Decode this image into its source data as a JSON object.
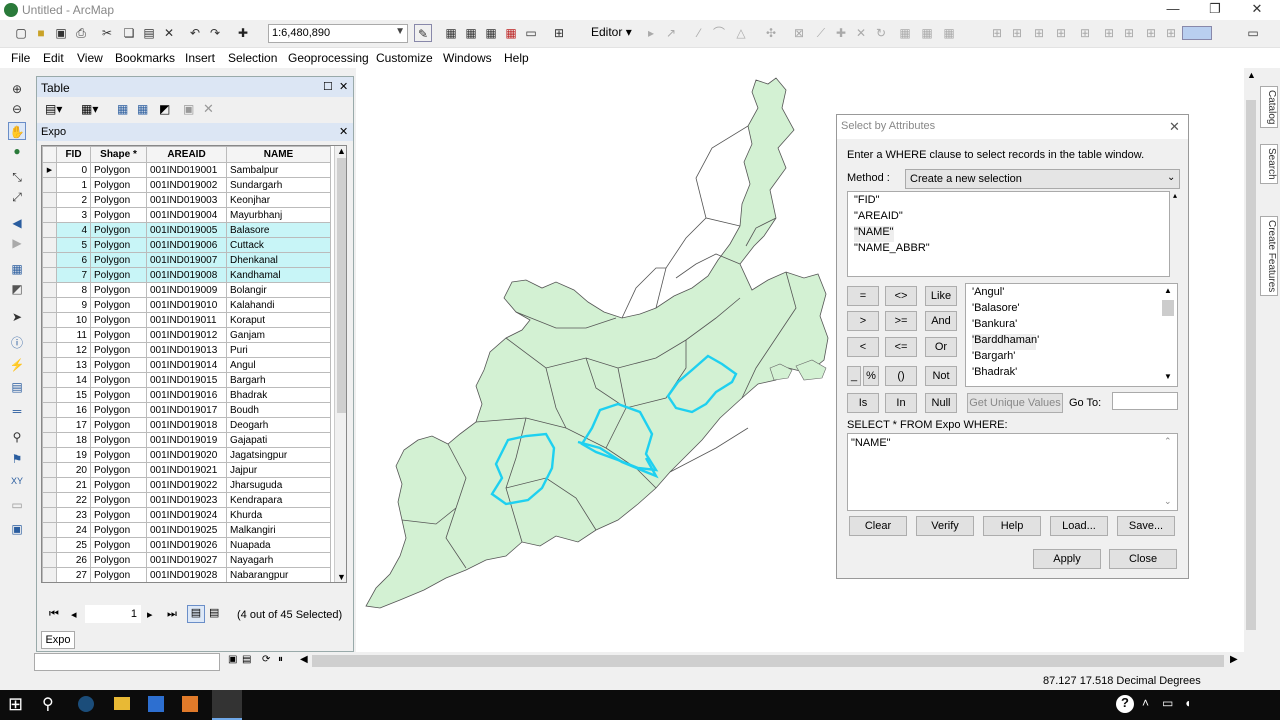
{
  "window": {
    "title": "Untitled - ArcMap"
  },
  "toolbar": {
    "scale_value": "1:6,480,890",
    "editor_label": "Editor"
  },
  "menu": [
    "File",
    "Edit",
    "View",
    "Bookmarks",
    "Insert",
    "Selection",
    "Geoprocessing",
    "Customize",
    "Windows",
    "Help"
  ],
  "table_window": {
    "title": "Table",
    "layer_tab": "Expo",
    "columns": [
      "FID",
      "Shape *",
      "AREAID",
      "NAME"
    ],
    "rows": [
      {
        "fid": "0",
        "shape": "Polygon",
        "areaid": "001IND019001",
        "name": "Sambalpur",
        "selected": false
      },
      {
        "fid": "1",
        "shape": "Polygon",
        "areaid": "001IND019002",
        "name": "Sundargarh",
        "selected": false
      },
      {
        "fid": "2",
        "shape": "Polygon",
        "areaid": "001IND019003",
        "name": "Keonjhar",
        "selected": false
      },
      {
        "fid": "3",
        "shape": "Polygon",
        "areaid": "001IND019004",
        "name": "Mayurbhanj",
        "selected": false
      },
      {
        "fid": "4",
        "shape": "Polygon",
        "areaid": "001IND019005",
        "name": "Balasore",
        "selected": true
      },
      {
        "fid": "5",
        "shape": "Polygon",
        "areaid": "001IND019006",
        "name": "Cuttack",
        "selected": true
      },
      {
        "fid": "6",
        "shape": "Polygon",
        "areaid": "001IND019007",
        "name": "Dhenkanal",
        "selected": true
      },
      {
        "fid": "7",
        "shape": "Polygon",
        "areaid": "001IND019008",
        "name": "Kandhamal",
        "selected": true
      },
      {
        "fid": "8",
        "shape": "Polygon",
        "areaid": "001IND019009",
        "name": "Bolangir",
        "selected": false
      },
      {
        "fid": "9",
        "shape": "Polygon",
        "areaid": "001IND019010",
        "name": "Kalahandi",
        "selected": false
      },
      {
        "fid": "10",
        "shape": "Polygon",
        "areaid": "001IND019011",
        "name": "Koraput",
        "selected": false
      },
      {
        "fid": "11",
        "shape": "Polygon",
        "areaid": "001IND019012",
        "name": "Ganjam",
        "selected": false
      },
      {
        "fid": "12",
        "shape": "Polygon",
        "areaid": "001IND019013",
        "name": "Puri",
        "selected": false
      },
      {
        "fid": "13",
        "shape": "Polygon",
        "areaid": "001IND019014",
        "name": "Angul",
        "selected": false
      },
      {
        "fid": "14",
        "shape": "Polygon",
        "areaid": "001IND019015",
        "name": "Bargarh",
        "selected": false
      },
      {
        "fid": "15",
        "shape": "Polygon",
        "areaid": "001IND019016",
        "name": "Bhadrak",
        "selected": false
      },
      {
        "fid": "16",
        "shape": "Polygon",
        "areaid": "001IND019017",
        "name": "Boudh",
        "selected": false
      },
      {
        "fid": "17",
        "shape": "Polygon",
        "areaid": "001IND019018",
        "name": "Deogarh",
        "selected": false
      },
      {
        "fid": "18",
        "shape": "Polygon",
        "areaid": "001IND019019",
        "name": "Gajapati",
        "selected": false
      },
      {
        "fid": "19",
        "shape": "Polygon",
        "areaid": "001IND019020",
        "name": "Jagatsingpur",
        "selected": false
      },
      {
        "fid": "20",
        "shape": "Polygon",
        "areaid": "001IND019021",
        "name": "Jajpur",
        "selected": false
      },
      {
        "fid": "21",
        "shape": "Polygon",
        "areaid": "001IND019022",
        "name": "Jharsuguda",
        "selected": false
      },
      {
        "fid": "22",
        "shape": "Polygon",
        "areaid": "001IND019023",
        "name": "Kendrapara",
        "selected": false
      },
      {
        "fid": "23",
        "shape": "Polygon",
        "areaid": "001IND019024",
        "name": "Khurda",
        "selected": false
      },
      {
        "fid": "24",
        "shape": "Polygon",
        "areaid": "001IND019025",
        "name": "Malkangiri",
        "selected": false
      },
      {
        "fid": "25",
        "shape": "Polygon",
        "areaid": "001IND019026",
        "name": "Nuapada",
        "selected": false
      },
      {
        "fid": "26",
        "shape": "Polygon",
        "areaid": "001IND019027",
        "name": "Nayagarh",
        "selected": false
      },
      {
        "fid": "27",
        "shape": "Polygon",
        "areaid": "001IND019028",
        "name": "Nabarangpur",
        "selected": false
      }
    ],
    "record_number": "1",
    "selection_status": "(4 out of 45 Selected)",
    "bottom_tab": "Expo"
  },
  "dialog": {
    "title": "Select by Attributes",
    "instruction": "Enter a WHERE clause to select records in the table window.",
    "method_label": "Method :",
    "method_value": "Create a new selection",
    "fields": [
      "\"FID\"",
      "\"AREAID\"",
      "\"NAME\"",
      "\"NAME_ABBR\""
    ],
    "operators": [
      [
        "=",
        "<>",
        "Like"
      ],
      [
        ">",
        ">=",
        "And"
      ],
      [
        "<",
        "<=",
        "Or"
      ],
      [
        "_",
        "%",
        "()",
        "Not"
      ]
    ],
    "ops_row2": [
      "Is",
      "In",
      "Null"
    ],
    "values": [
      "'Angul'",
      "'Balasore'",
      "'Bankura'",
      "'Barddhaman'",
      "'Bargarh'",
      "'Bhadrak'"
    ],
    "get_unique_values": "Get Unique Values",
    "goto_label": "Go To:",
    "query_prefix": "SELECT * FROM Expo WHERE:",
    "query_text": "\"NAME\"",
    "btn_clear": "Clear",
    "btn_verify": "Verify",
    "btn_help": "Help",
    "btn_load": "Load...",
    "btn_save": "Save...",
    "btn_apply": "Apply",
    "btn_close": "Close"
  },
  "right_tabs": [
    "Catalog",
    "Search",
    "Create Features"
  ],
  "status": {
    "coords": "87.127  17.518 Decimal Degrees"
  },
  "colors": {
    "selection_row": "#c8f5f7",
    "map_fill": "#d3f1d3",
    "selection_outline": "#1ed0f0"
  }
}
